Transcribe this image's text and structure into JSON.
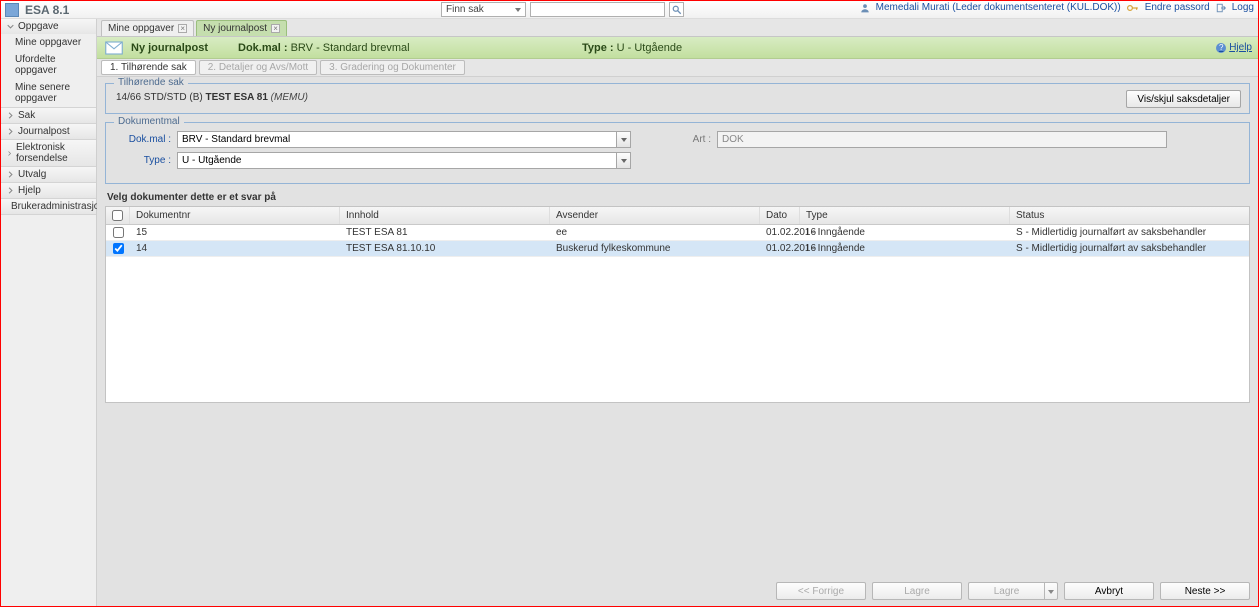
{
  "app": {
    "title": "ESA 8.1"
  },
  "topbar": {
    "search_combo": "Finn sak",
    "search_value": "",
    "user_text": "Memedali Murati (Leder dokumentsenteret (KUL.DOK))",
    "change_pw": "Endre passord",
    "logout": "Logg"
  },
  "sidebar": {
    "sections": [
      "Oppgave",
      "Sak",
      "Journalpost",
      "Elektronisk forsendelse",
      "Utvalg",
      "Hjelp",
      "Brukeradministrasjon"
    ],
    "oppgave_children": [
      "Mine oppgaver",
      "Ufordelte oppgaver",
      "Mine senere oppgaver"
    ]
  },
  "tabs": {
    "t1": "Mine oppgaver",
    "t2": "Ny journalpost"
  },
  "greenhead": {
    "title": "Ny journalpost",
    "dokmal_label": "Dok.mal :",
    "dokmal_value": "BRV - Standard brevmal",
    "type_label": "Type :",
    "type_value": "U - Utgående",
    "help": "Hjelp"
  },
  "steps": {
    "s1": "1. Tilhørende sak",
    "s2": "2. Detaljer og Avs/Mott",
    "s3": "3. Gradering og Dokumenter"
  },
  "case": {
    "legend": "Tilhørende sak",
    "line_prefix": "14/66 STD/STD (B) ",
    "line_bold": "TEST ESA 81",
    "line_suffix": " (MEMU)",
    "btn": "Vis/skjul saksdetaljer"
  },
  "docmal": {
    "legend": "Dokumentmal",
    "dokmal_label": "Dok.mal :",
    "dokmal_value": "BRV - Standard brevmal",
    "type_label": "Type :",
    "type_value": "U - Utgående",
    "art_label": "Art :",
    "art_value": "DOK"
  },
  "velg": {
    "title": "Velg dokumenter dette er et svar på",
    "cols": {
      "c1": "Dokumentnr",
      "c2": "Innhold",
      "c3": "Avsender",
      "c4": "Dato",
      "c5": "Type",
      "c6": "Status"
    },
    "rows": [
      {
        "chk": false,
        "c1": "15",
        "c2": "TEST ESA 81",
        "c3": "ee",
        "c4": "01.02.2016",
        "c5": "I - Inngående",
        "c6": "S - Midlertidig journalført av saksbehandler"
      },
      {
        "chk": true,
        "c1": "14",
        "c2": "TEST ESA 81.10.10",
        "c3": "Buskerud fylkeskommune",
        "c4": "01.02.2016",
        "c5": "I - Inngående",
        "c6": "S - Midlertidig journalført av saksbehandler"
      }
    ]
  },
  "footer": {
    "prev": "<< Forrige",
    "save": "Lagre",
    "save2": "Lagre",
    "cancel": "Avbryt",
    "next": "Neste >>"
  }
}
